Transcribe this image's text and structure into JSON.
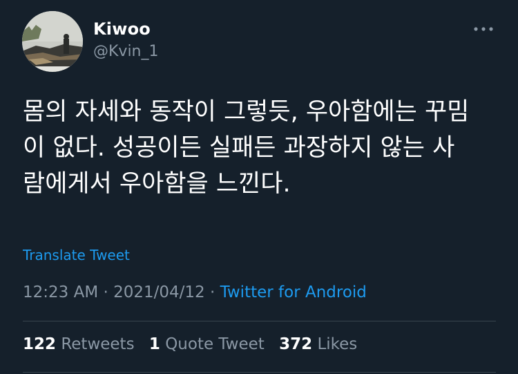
{
  "user": {
    "display_name": "Kiwoo",
    "handle": "@Kvin_1",
    "avatar_icon": "profile-photo"
  },
  "more_icon": "ellipsis-icon",
  "tweet": {
    "lines": [
      "몸의 자세와 동작이 그렇듯, 우아함에는 꾸밈",
      "이 없다. 성공이든 실패든 과장하지 않는 사",
      "람에게서 우아함을 느낀다."
    ],
    "translate_label": "Translate Tweet"
  },
  "meta": {
    "time": "12:23 AM",
    "date": "2021/04/12",
    "separator": "·",
    "source": "Twitter for Android"
  },
  "stats": {
    "retweets_count": "122",
    "retweets_label": "Retweets",
    "quotes_count": "1",
    "quotes_label": "Quote Tweet",
    "likes_count": "372",
    "likes_label": "Likes"
  },
  "colors": {
    "background": "#15202b",
    "link": "#1d9bf0",
    "secondary_text": "#8b98a5",
    "divider": "#38444d"
  }
}
